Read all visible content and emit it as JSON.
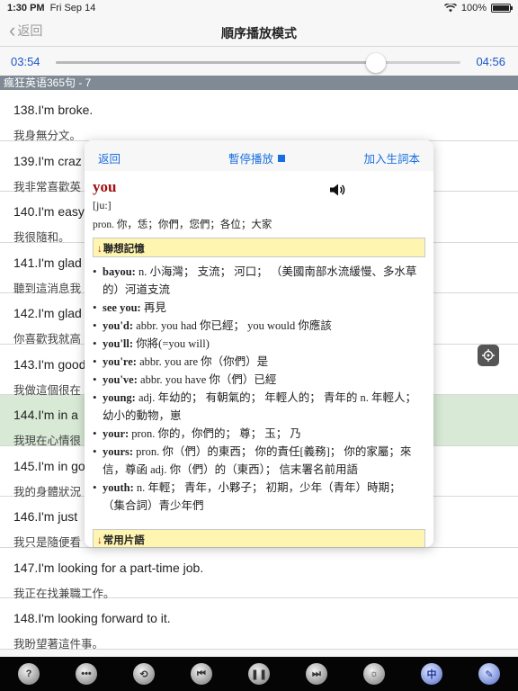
{
  "status_bar": {
    "time": "1:30 PM",
    "date": "Fri Sep 14",
    "battery": "100%"
  },
  "nav": {
    "back_label": "返回",
    "title": "順序播放模式"
  },
  "player": {
    "elapsed": "03:54",
    "total": "04:56",
    "progress": 0.79
  },
  "section_header": "瘋狂英语365句 - 7",
  "sentences": [
    {
      "en": "138.I'm broke.",
      "zh": "我身無分文。"
    },
    {
      "en": "139.I'm craz",
      "zh": "我非常喜歡英"
    },
    {
      "en": "140.I'm easy",
      "zh": "我很隨和。"
    },
    {
      "en": "141.I'm glad",
      "zh": "聽到這消息我"
    },
    {
      "en": "142.I'm glad",
      "zh": "你喜歡我就高"
    },
    {
      "en": "143.I'm good",
      "zh": "我做這個很在"
    },
    {
      "en": "144.I'm in a",
      "zh": "我現在心情很"
    },
    {
      "en": "145.I'm in go",
      "zh": "我的身體狀況"
    },
    {
      "en": "146.I'm just",
      "zh": "我只是隨便看"
    },
    {
      "en": "147.I'm looking for a part-time job.",
      "zh": "我正在找兼職工作。"
    },
    {
      "en": "148.I'm looking forward to it.",
      "zh": "我盼望著這件事。"
    }
  ],
  "highlight_index": 6,
  "dictionary": {
    "back_label": "返回",
    "pause_label": "暫停播放",
    "add_label": "加入生詞本",
    "word": "you",
    "pronunciation": "[ju:]",
    "definition": "pron. 你，恁；你們，您們；各位；大家",
    "association_header": "聯想記憶",
    "phrases_header": "常用片語",
    "entries": [
      {
        "hw": "bayou:",
        "text": " n. 小海灣； 支流； 河口； （美國南部水流緩慢、多水草的）河道支流"
      },
      {
        "hw": "see you:",
        "text": " 再見"
      },
      {
        "hw": "you'd:",
        "text": " abbr. you had 你已經； you would 你應該"
      },
      {
        "hw": "you'll:",
        "text": " 你將(=you will)"
      },
      {
        "hw": "you're:",
        "text": " abbr. you are 你（你們）是"
      },
      {
        "hw": "you've:",
        "text": " abbr. you have 你（們）已經"
      },
      {
        "hw": "young:",
        "text": " adj. 年幼的； 有朝氣的； 年輕人的； 青年的 n. 年輕人； 幼小的動物，崽"
      },
      {
        "hw": "your:",
        "text": " pron. 你的，你們的； 尊； 玉； 乃"
      },
      {
        "hw": "yours:",
        "text": " pron. 你（們）的東西； 你的責任[義務]； 你的家屬；來信，尊函 adj. 你（們）的（東西）； 信末署名前用語"
      },
      {
        "hw": "youth:",
        "text": " n. 年輕； 青年，小夥子； 初期，少年（青年）時期； （集合詞）青少年們"
      }
    ]
  },
  "toolbar": {
    "lang_label": "中"
  }
}
